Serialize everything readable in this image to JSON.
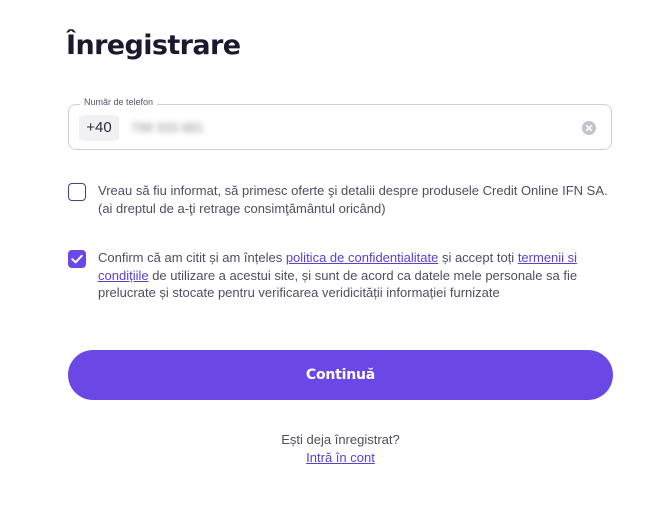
{
  "form": {
    "title": "Înregistrare",
    "phone": {
      "label": "Număr de telefon",
      "prefix": "+40",
      "value": "799 333 681"
    },
    "marketing_consent": {
      "checked": false,
      "text": "Vreau să fiu informat, să primesc oferte şi detalii despre produsele Credit Online IFN SA. (ai dreptul de a-ţi retrage consimţământul oricând)"
    },
    "terms_consent": {
      "checked": true,
      "text_1": "Confirm că am citit și am înțeles ",
      "link_privacy": "politica de confidentialitate",
      "text_2": " și accept toți ",
      "link_terms": "termenii si condițiile",
      "text_3": " de utilizare a acestui site, și sunt de acord ca datele mele personale sa fie prelucrate și stocate pentru verificarea veridicității informației furnizate"
    },
    "continue_label": "Continuă",
    "login_prompt": "Ești deja înregistrat?",
    "login_link": "Intră în cont"
  },
  "colors": {
    "accent": "#6b48e6",
    "link": "#5b3fd0",
    "title": "#1a1a2e"
  }
}
